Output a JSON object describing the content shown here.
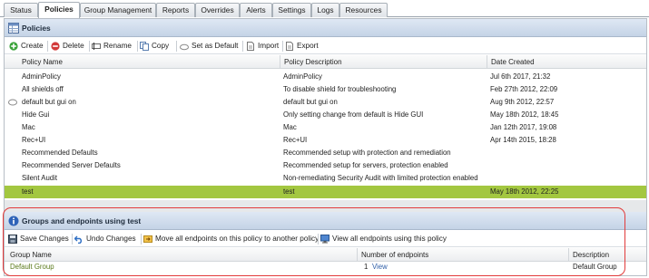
{
  "tabs": [
    {
      "label": "Status"
    },
    {
      "label": "Policies"
    },
    {
      "label": "Group Management"
    },
    {
      "label": "Reports"
    },
    {
      "label": "Overrides"
    },
    {
      "label": "Alerts"
    },
    {
      "label": "Settings"
    },
    {
      "label": "Logs"
    },
    {
      "label": "Resources"
    }
  ],
  "policies": {
    "title": "Policies",
    "toolbar": {
      "create": "Create",
      "delete": "Delete",
      "rename": "Rename",
      "copy": "Copy",
      "set_default": "Set as Default",
      "import": "Import",
      "export": "Export"
    },
    "columns": [
      "Policy Name",
      "Policy Description",
      "Date Created"
    ],
    "rows": [
      {
        "name": "AdminPolicy",
        "description": "AdminPolicy",
        "date": "Jul 6th 2017, 21:32"
      },
      {
        "name": "All shields off",
        "description": "To disable shield for troubleshooting",
        "date": "Feb 27th 2012, 22:09"
      },
      {
        "name": "default but gui on",
        "description": "default but gui on",
        "date": "Aug 9th 2012, 22:57"
      },
      {
        "name": "Hide Gui",
        "description": "Only setting change from default is Hide GUI",
        "date": "May 18th 2012, 18:45"
      },
      {
        "name": "Mac",
        "description": "Mac",
        "date": "Jan 12th 2017, 19:08"
      },
      {
        "name": "Rec+UI",
        "description": "Rec+UI",
        "date": "Apr 14th 2015, 18:28"
      },
      {
        "name": "Recommended Defaults",
        "description": "Recommended setup with protection and remediation",
        "date": ""
      },
      {
        "name": "Recommended Server Defaults",
        "description": "Recommended setup for servers, protection enabled",
        "date": ""
      },
      {
        "name": "Silent Audit",
        "description": "Non-remediating Security Audit with limited protection enabled",
        "date": ""
      },
      {
        "name": "test",
        "description": "test",
        "date": "May 18th 2012, 22:25"
      }
    ],
    "selected_row": "test"
  },
  "groups": {
    "title": "Groups and endpoints using test",
    "toolbar": {
      "save": "Save Changes",
      "undo": "Undo Changes",
      "move": "Move all endpoints on this policy to another policy",
      "view": "View all endpoints using this policy"
    },
    "columns": [
      "Group Name",
      "Number of endpoints",
      "Description"
    ],
    "rows": [
      {
        "name": "Default Group",
        "count": "1",
        "view_label": "View",
        "description": "Default Group"
      }
    ]
  },
  "colors": {
    "selected_row": "#a3c740",
    "callout": "#e23b3b",
    "header_bg": "#c4d3e6"
  }
}
